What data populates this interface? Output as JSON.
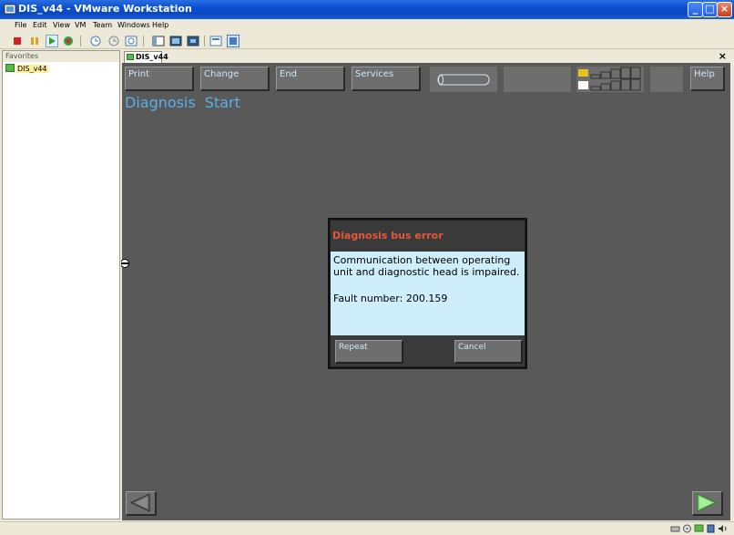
{
  "window": {
    "title": "DIS_v44 - VMware Workstation",
    "controls": {
      "minimize": "_",
      "maximize": "□",
      "close": "×"
    }
  },
  "menu": [
    "File",
    "Edit",
    "View",
    "VM",
    "Team",
    "Windows",
    "Help"
  ],
  "favorites": {
    "header": "Favorites",
    "items": [
      {
        "label": "DIS_v44"
      }
    ]
  },
  "vm_tab": {
    "label": "DIS_v44",
    "close": "×"
  },
  "guest": {
    "buttons": {
      "print": "Print",
      "change": "Change",
      "end": "End",
      "services": "Services",
      "help": "Help"
    },
    "title": {
      "word1": "Diagnosis",
      "word2": "Start"
    },
    "dialog": {
      "title": "Diagnosis bus error",
      "message": "Communication between operating unit and diagnostic head is impaired.",
      "fault": "Fault number: 200.159",
      "repeat": "Repeat",
      "cancel": "Cancel"
    }
  },
  "colors": {
    "titlebar": "#0a4fd0",
    "guest_bg": "#595959",
    "guest_button": "#6e6e6e",
    "guest_title": "#5aaee8",
    "dialog_title": "#e2583a",
    "dialog_body": "#cdeefa",
    "nav_arrow_left": "#6a6a6a",
    "nav_arrow_right": "#7fd87a"
  }
}
